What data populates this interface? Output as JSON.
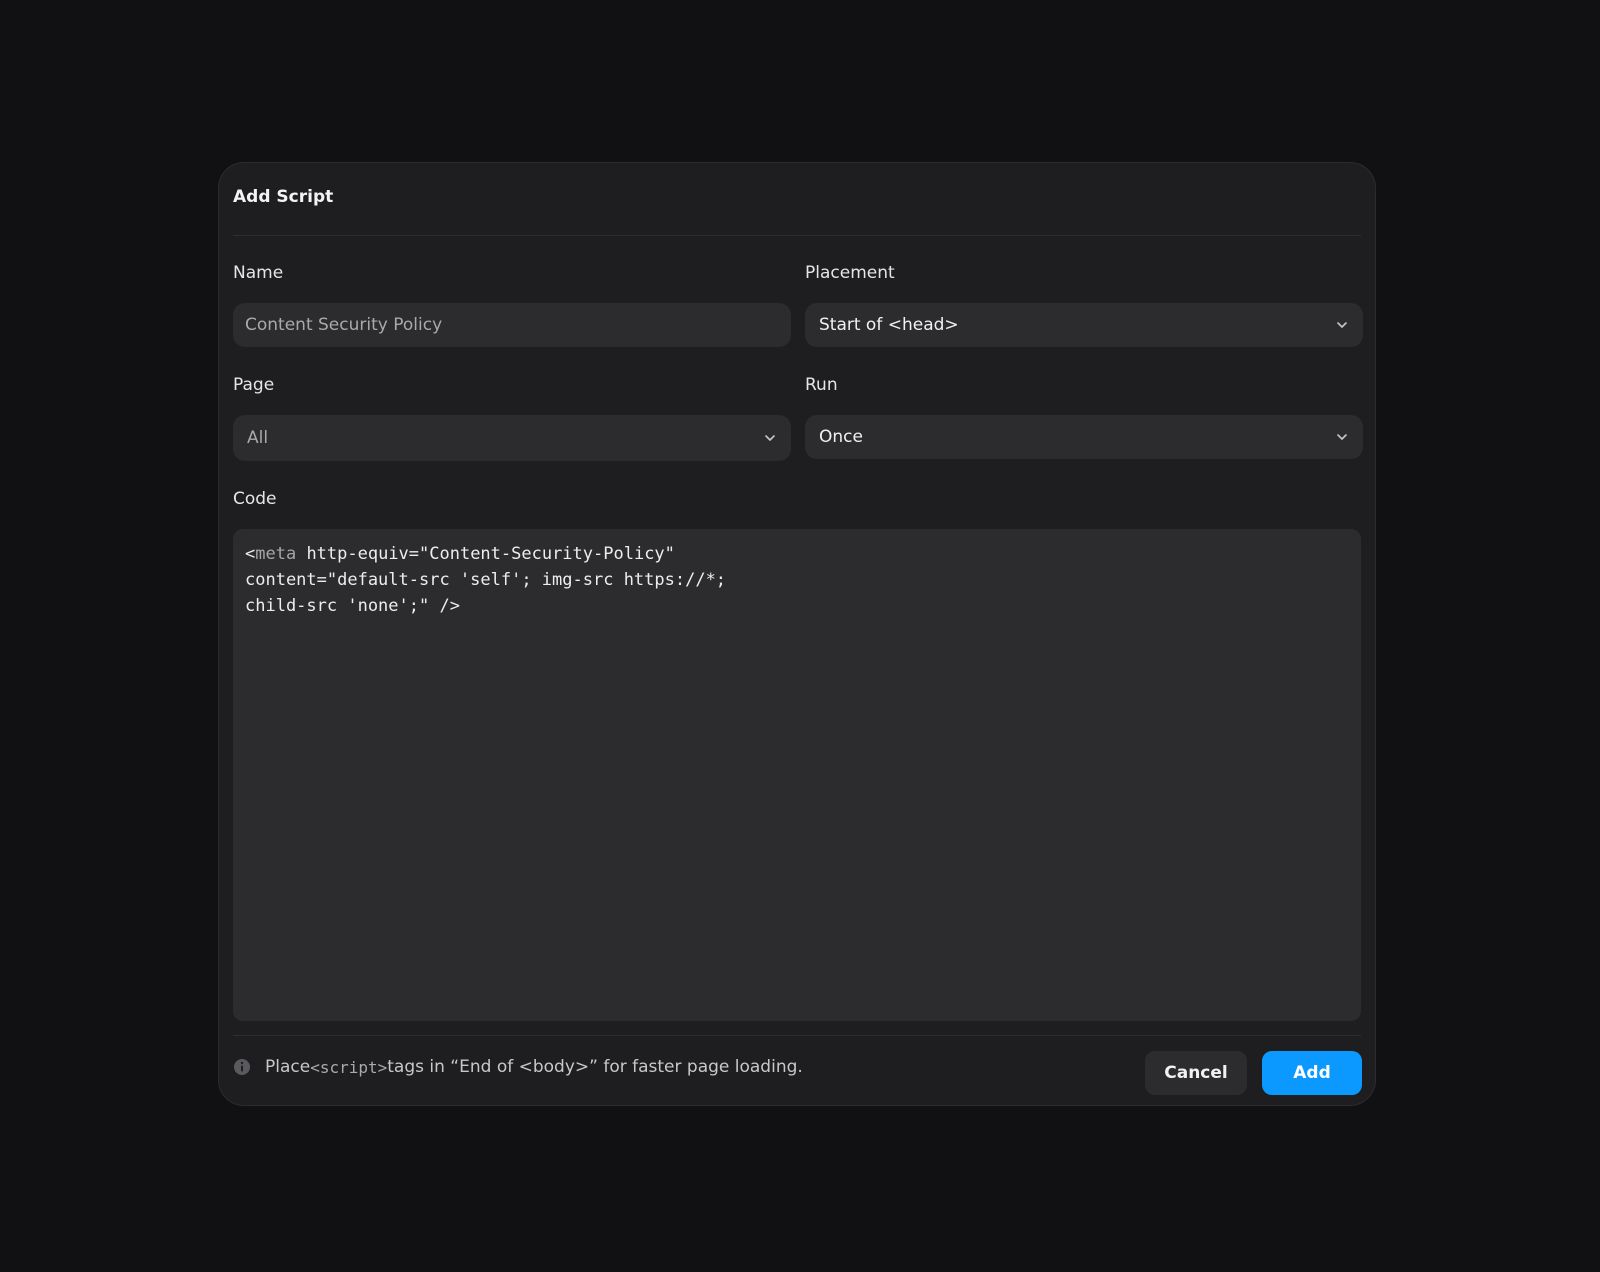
{
  "dialog": {
    "title": "Add Script"
  },
  "form": {
    "name": {
      "label": "Name",
      "value": "Content Security Policy"
    },
    "placement": {
      "label": "Placement",
      "selected": "Start of <head>"
    },
    "page": {
      "label": "Page",
      "selected": "All"
    },
    "run": {
      "label": "Run",
      "selected": "Once"
    },
    "code": {
      "label": "Code",
      "line1_open": "<",
      "line1_tag": "meta",
      "line1_rest": " http-equiv=\"Content-Security-Policy\"",
      "line2": "content=\"default-src 'self'; img-src https://*;",
      "line3": "child-src 'none';\" />"
    }
  },
  "footer": {
    "note_prefix": "Place ",
    "note_code": "<script>",
    "note_suffix": " tags in “End of <body>” for faster page loading.",
    "cancel_label": "Cancel",
    "add_label": "Add"
  },
  "icons": {
    "info": "info-icon",
    "chevron": "chevron-down-icon"
  },
  "colors": {
    "background": "#111113",
    "dialog": "#1e1e20",
    "field": "#2c2c2e",
    "accent": "#0b99ff"
  }
}
